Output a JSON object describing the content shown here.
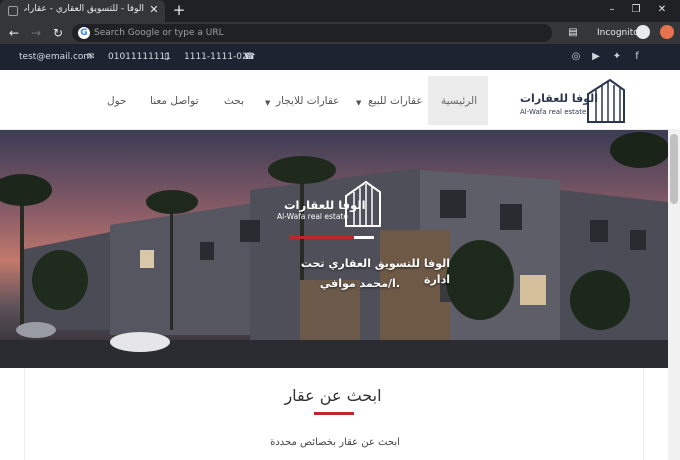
{
  "browser": {
    "tab_title": "الوفا - للتسويق العقاري - عقارات لا",
    "tab_close": "✕",
    "new_tab": "+",
    "window_controls": [
      "–",
      "❐",
      "✕"
    ],
    "omnibox_placeholder": "Search Google or type a URL",
    "google_glyph": "G",
    "incognito_label": "Incognito"
  },
  "infobar": {
    "email": "test@email.com",
    "phone_mobile": "01011111111",
    "phone_landline": "1111-1111-02",
    "socials": [
      "instagram-icon",
      "youtube-icon",
      "twitter-icon",
      "facebook-icon"
    ]
  },
  "nav": {
    "items": [
      {
        "label": "الرئيسية",
        "active": true
      },
      {
        "label": "عقارات للبيع",
        "dropdown": true
      },
      {
        "label": "عقارات للايجار",
        "dropdown": true
      },
      {
        "label": "بحث"
      },
      {
        "label": "تواصل معنا"
      },
      {
        "label": "حول"
      }
    ],
    "caret": "▼"
  },
  "brand": {
    "name_ar": "الوفا للعقارات",
    "name_en": "Al-Wafa real estate"
  },
  "hero": {
    "brand_ar": "الوفا للعقارات",
    "brand_en": "Al-Wafa real estate",
    "title": "الوفا للتسويق العقاري تحت ادارة",
    "subtitle": "ا/محمد موافي."
  },
  "search_section": {
    "title": "ابحث عن عقار",
    "subtitle": "ابحث عن عقار بخصائص محددة"
  },
  "colors": {
    "accent_red": "#c0252d",
    "dark_navy": "#1d2331",
    "brand_blue": "#2a3550"
  }
}
